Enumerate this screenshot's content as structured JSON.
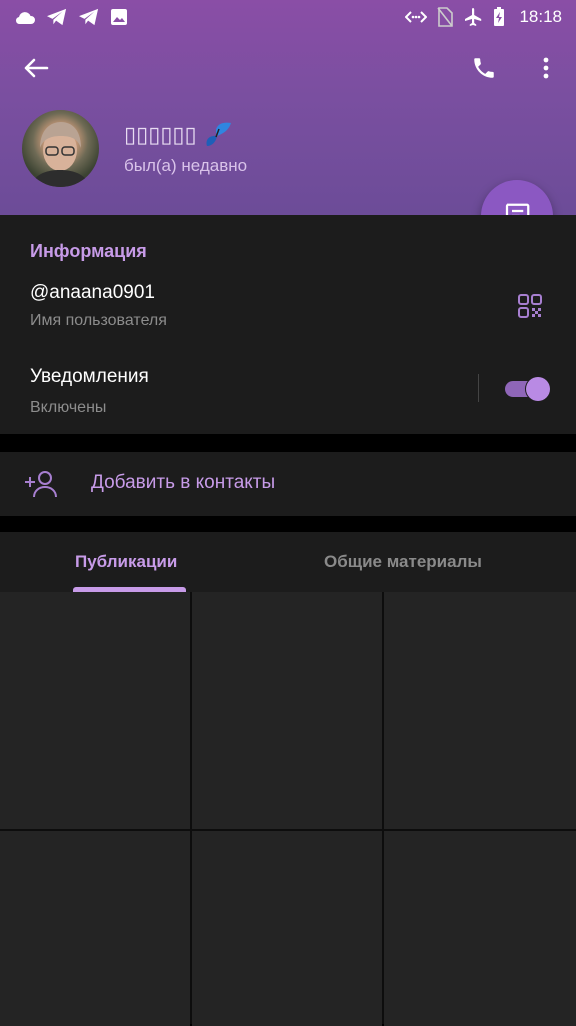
{
  "status_bar": {
    "time": "18:18",
    "left_icons": [
      "cloud-icon",
      "telegram-icon",
      "telegram-icon",
      "image-icon"
    ],
    "right_icons": [
      "code-brackets-icon",
      "no-sim-icon",
      "airplane-icon",
      "battery-charging-icon"
    ]
  },
  "header": {
    "name": "▯▯▯▯▯▯",
    "name_emoji": "butterfly",
    "status": "был(а) недавно",
    "accent_gradient": [
      "#8a4ea6",
      "#6c4c98"
    ]
  },
  "info": {
    "section_title": "Информация",
    "username": "@anaana0901",
    "username_label": "Имя пользователя",
    "notifications_title": "Уведомления",
    "notifications_status": "Включены",
    "notifications_enabled": true
  },
  "actions": {
    "add_contact_label": "Добавить в контакты"
  },
  "tabs": [
    {
      "label": "Публикации",
      "active": true
    },
    {
      "label": "Общие материалы",
      "active": false
    }
  ],
  "colors": {
    "accent": "#c79be8",
    "fab": "#8b58c2",
    "card_bg": "#1c1c1c",
    "grid_cell": "#242424"
  }
}
